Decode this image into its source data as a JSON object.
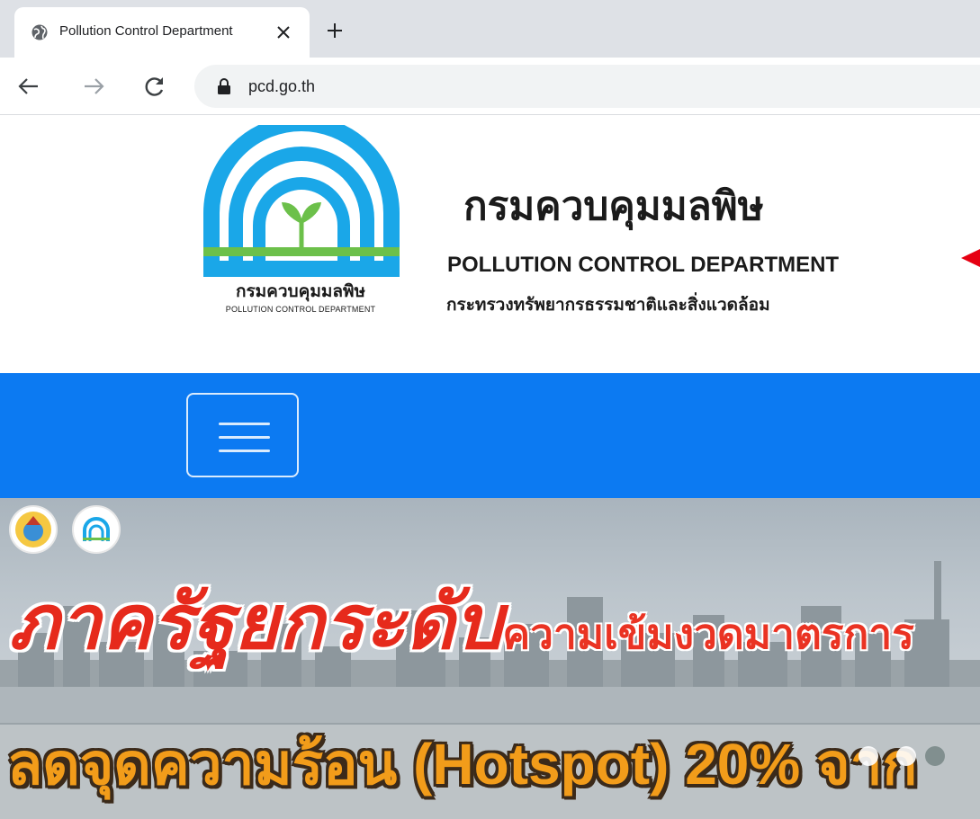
{
  "browser": {
    "tab_title": "Pollution Control Department",
    "url": "pcd.go.th"
  },
  "header": {
    "logo_th": "กรมควบคุมมลพิษ",
    "logo_en": "POLLUTION CONTROL DEPARTMENT",
    "title_th": "กรมควบคุมมลพิษ",
    "title_en": "POLLUTION CONTROL DEPARTMENT",
    "ministry": "กระทรวงทรัพยากรธรรมชาติและสิ่งแวดล้อม"
  },
  "banner": {
    "headline_main": "ภาครัฐยกระดับ",
    "headline_sub": "ความเข้มงวดมาตรการ",
    "headline_2": "ลดจุดความร้อน (Hotspot) 20% จาก",
    "slides": 3,
    "active_slide": 3
  },
  "colors": {
    "navbar": "#0c7af2",
    "arrow": "#e60012",
    "logo_blue": "#1aa7e8",
    "logo_green": "#6cc04a"
  },
  "icons": {
    "favicon": "globe-icon",
    "close": "close-icon",
    "new_tab": "plus-icon",
    "back": "back-arrow-icon",
    "forward": "forward-arrow-icon",
    "reload": "reload-icon",
    "lock": "lock-icon",
    "menu": "hamburger-menu-icon"
  }
}
